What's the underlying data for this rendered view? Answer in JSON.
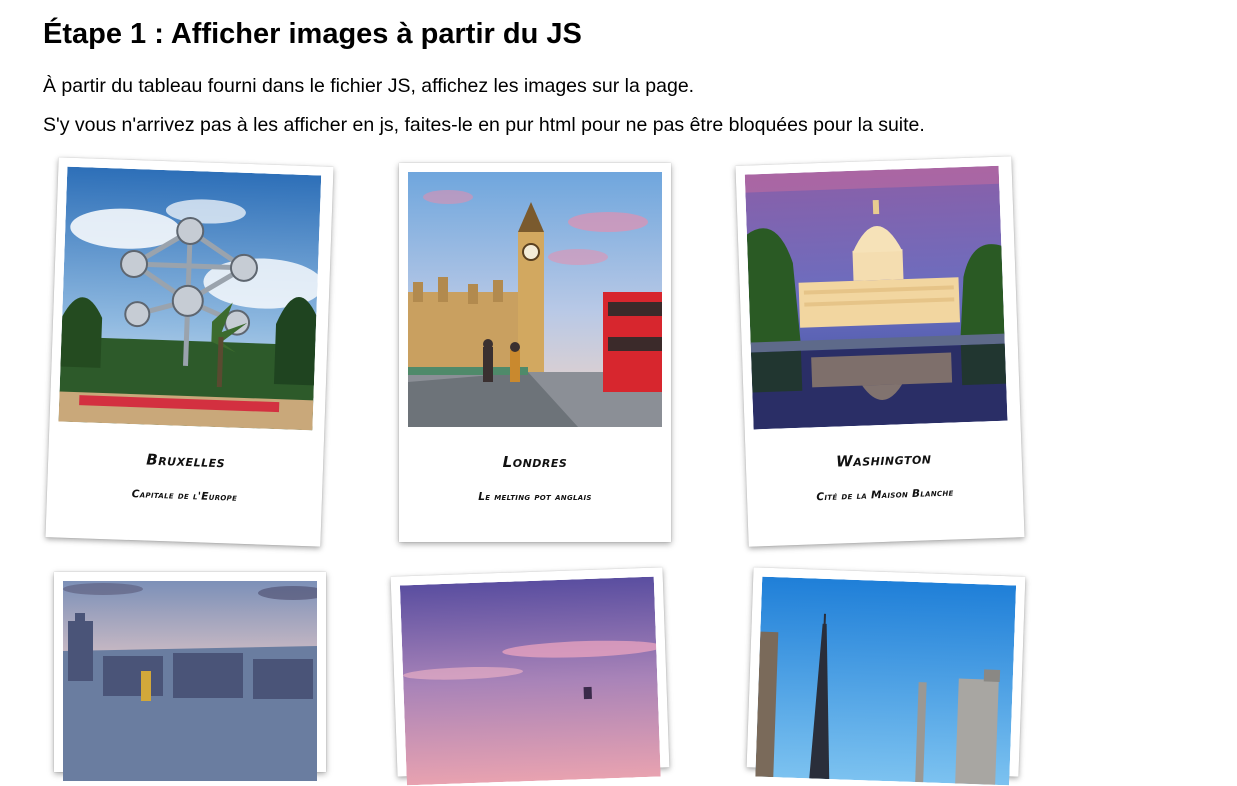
{
  "page": {
    "heading": "Étape 1 : Afficher images à partir du JS",
    "paragraphs": [
      "À partir du tableau fourni dans le fichier JS, affichez les images sur la page.",
      "S'y vous n'arrivez pas à les afficher en js, faites-le en pur html pour ne pas être bloquées pour la suite."
    ]
  },
  "cards": [
    {
      "title": "Bruxelles",
      "subtitle": "Capitale de l'Europe",
      "icon": "atomium-photo"
    },
    {
      "title": "Londres",
      "subtitle": "Le melting pot anglais",
      "icon": "big-ben-photo"
    },
    {
      "title": "Washington",
      "subtitle": "Cité de la Maison Blanche",
      "icon": "capitol-photo"
    },
    {
      "title": "",
      "subtitle": "",
      "icon": "city-skyline-photo"
    },
    {
      "title": "",
      "subtitle": "",
      "icon": "sunset-sky-photo"
    },
    {
      "title": "",
      "subtitle": "",
      "icon": "eiffel-tower-photo"
    }
  ]
}
